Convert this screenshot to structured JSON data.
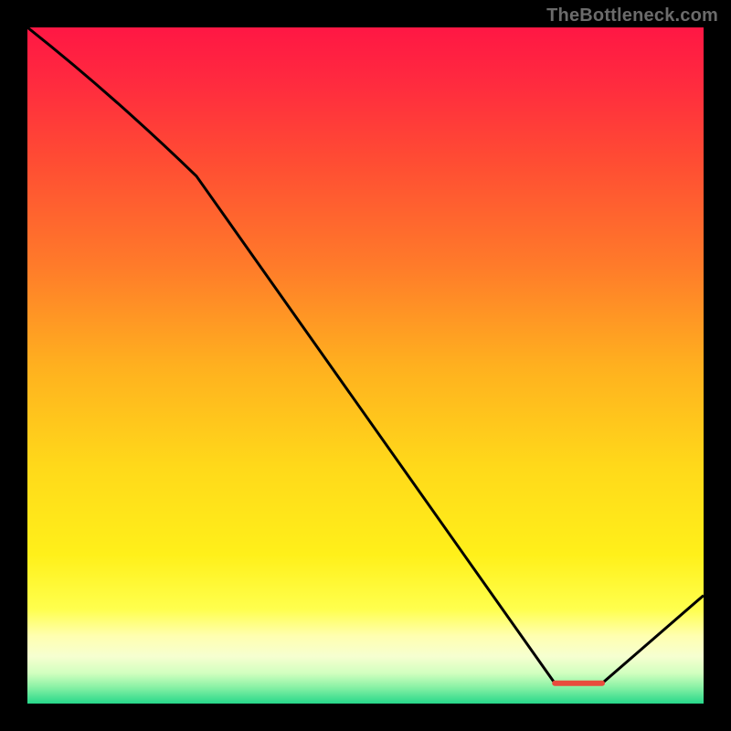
{
  "watermark": "TheBottleneck.com",
  "colors": {
    "frame": "#000000",
    "line": "#000000",
    "watermark_text": "#6b6b6b",
    "gradient_stops": [
      {
        "offset": 0.0,
        "color": "#ff1744"
      },
      {
        "offset": 0.08,
        "color": "#ff2a3f"
      },
      {
        "offset": 0.2,
        "color": "#ff4d33"
      },
      {
        "offset": 0.35,
        "color": "#ff7a2a"
      },
      {
        "offset": 0.5,
        "color": "#ffb01f"
      },
      {
        "offset": 0.65,
        "color": "#ffd91a"
      },
      {
        "offset": 0.78,
        "color": "#fff01a"
      },
      {
        "offset": 0.86,
        "color": "#ffff4d"
      },
      {
        "offset": 0.9,
        "color": "#ffffb0"
      },
      {
        "offset": 0.93,
        "color": "#f6ffd0"
      },
      {
        "offset": 0.955,
        "color": "#d2ffbf"
      },
      {
        "offset": 0.975,
        "color": "#8cf2a6"
      },
      {
        "offset": 1.0,
        "color": "#27d88a"
      }
    ],
    "marker_color": "#e84c3d"
  },
  "chart_data": {
    "type": "line",
    "title": "",
    "xlabel": "",
    "ylabel": "",
    "xlim": [
      0,
      100
    ],
    "ylim": [
      0,
      100
    ],
    "x": [
      0,
      25,
      78,
      85,
      100
    ],
    "values": [
      100,
      78,
      3,
      3,
      16
    ],
    "marker_segment": {
      "x0": 78,
      "x1": 85,
      "y": 3
    },
    "notes": "Background is a vertical heat gradient from red (top, high distance) to green (bottom, near-zero distance). The black curve tracks some percentage metric vs an x-axis parameter; the flat red segment marks the curve's minimum (~3% around x 78–85)."
  }
}
